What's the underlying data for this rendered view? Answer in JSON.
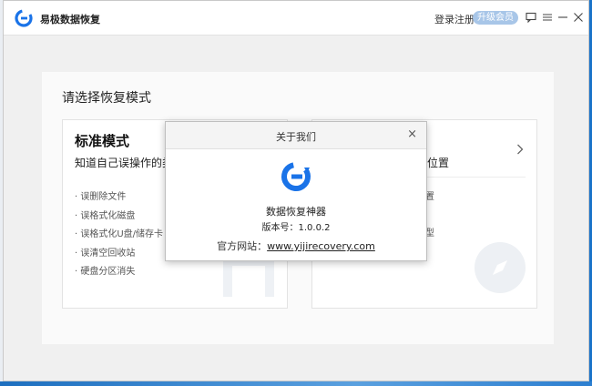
{
  "app": {
    "title": "易极数据恢复",
    "login_label": "登录注册",
    "vip_label": "升级会员",
    "brand_color": "#1a73e8"
  },
  "titlebar_icons": [
    "chat-icon",
    "menu-icon",
    "minimize-icon",
    "close-icon"
  ],
  "main": {
    "heading": "请选择恢复模式",
    "standard_card": {
      "title": "标准模式",
      "description": "知道自己误操作的类型",
      "items": [
        "· 误删除文件",
        "· 误格式化磁盘",
        "· 误格式化U盘/储存卡",
        "· 误清空回收站",
        "· 硬盘分区消失"
      ]
    },
    "advanced_card": {
      "description_fragment": "概位置",
      "items": [
        "位置",
        "类型"
      ]
    }
  },
  "about_dialog": {
    "title": "关于我们",
    "close_glyph": "×",
    "product_name": "数据恢复神器",
    "version_text": "版本号：1.0.0.2",
    "website_label": "官方网站：",
    "website_url": "www.yijirecovery.com"
  }
}
